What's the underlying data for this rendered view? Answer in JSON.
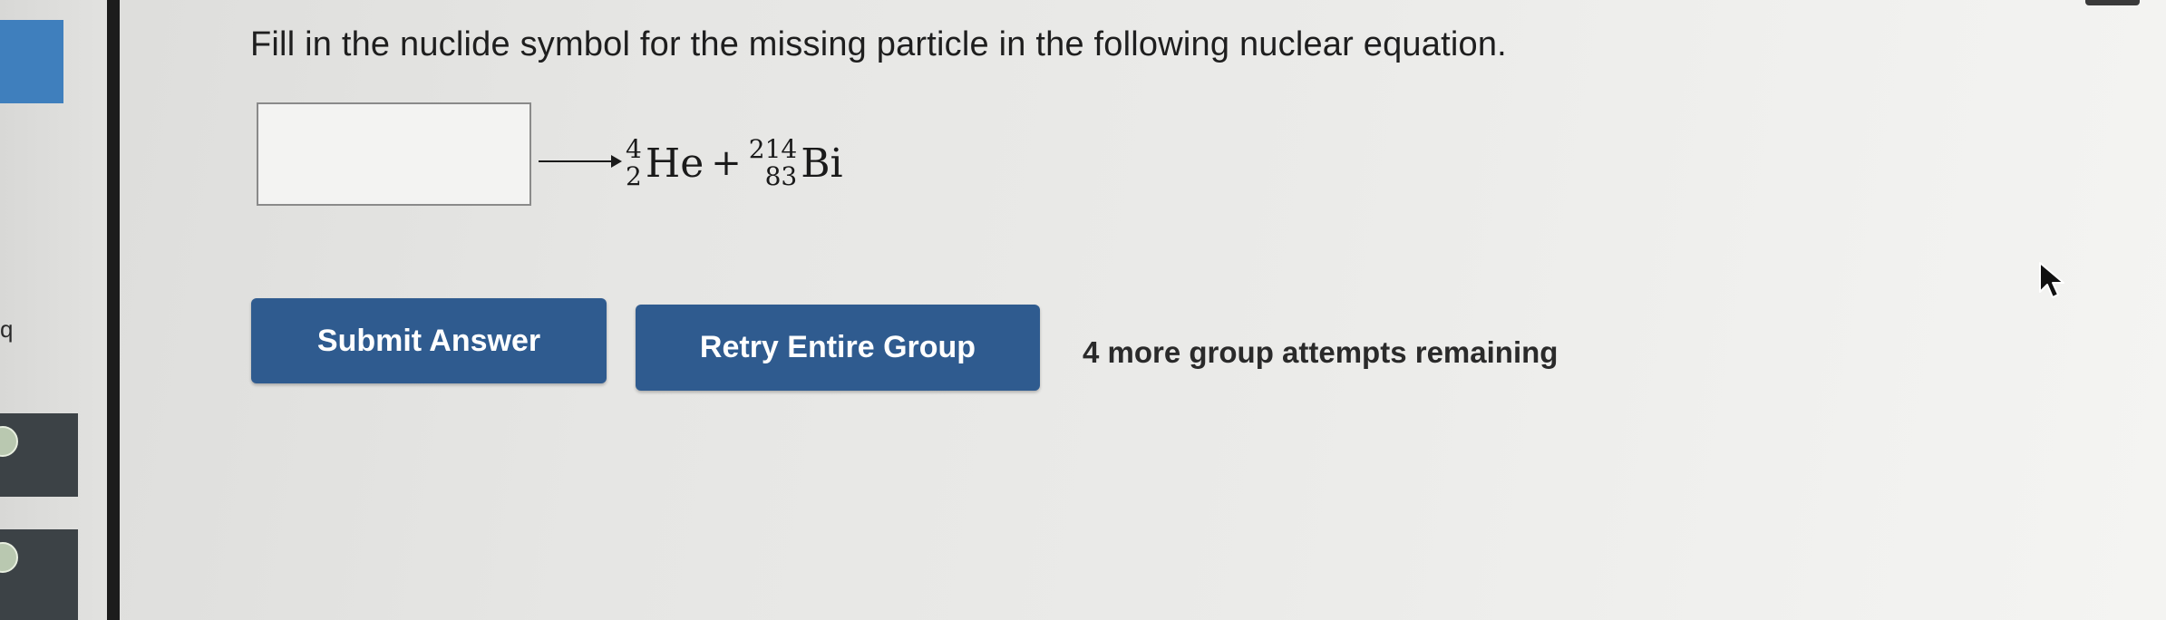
{
  "question": {
    "text": "Fill in the nuclide symbol for the missing particle in the following nuclear equation."
  },
  "equation": {
    "answer_value": "",
    "products": [
      {
        "mass_number": "4",
        "atomic_number": "2",
        "symbol": "He"
      },
      {
        "mass_number": "214",
        "atomic_number": "83",
        "symbol": "Bi"
      }
    ],
    "plus": "+"
  },
  "actions": {
    "submit_label": "Submit Answer",
    "retry_label": "Retry Entire Group",
    "attempts_text": "4 more group attempts remaining"
  },
  "sidebar": {
    "letter": "q"
  },
  "colors": {
    "button": "#2f5b8f",
    "sidebar_tab": "#3f7fbd"
  },
  "icons": {
    "cursor": "mouse-pointer-icon",
    "arrow": "reaction-arrow-icon"
  }
}
